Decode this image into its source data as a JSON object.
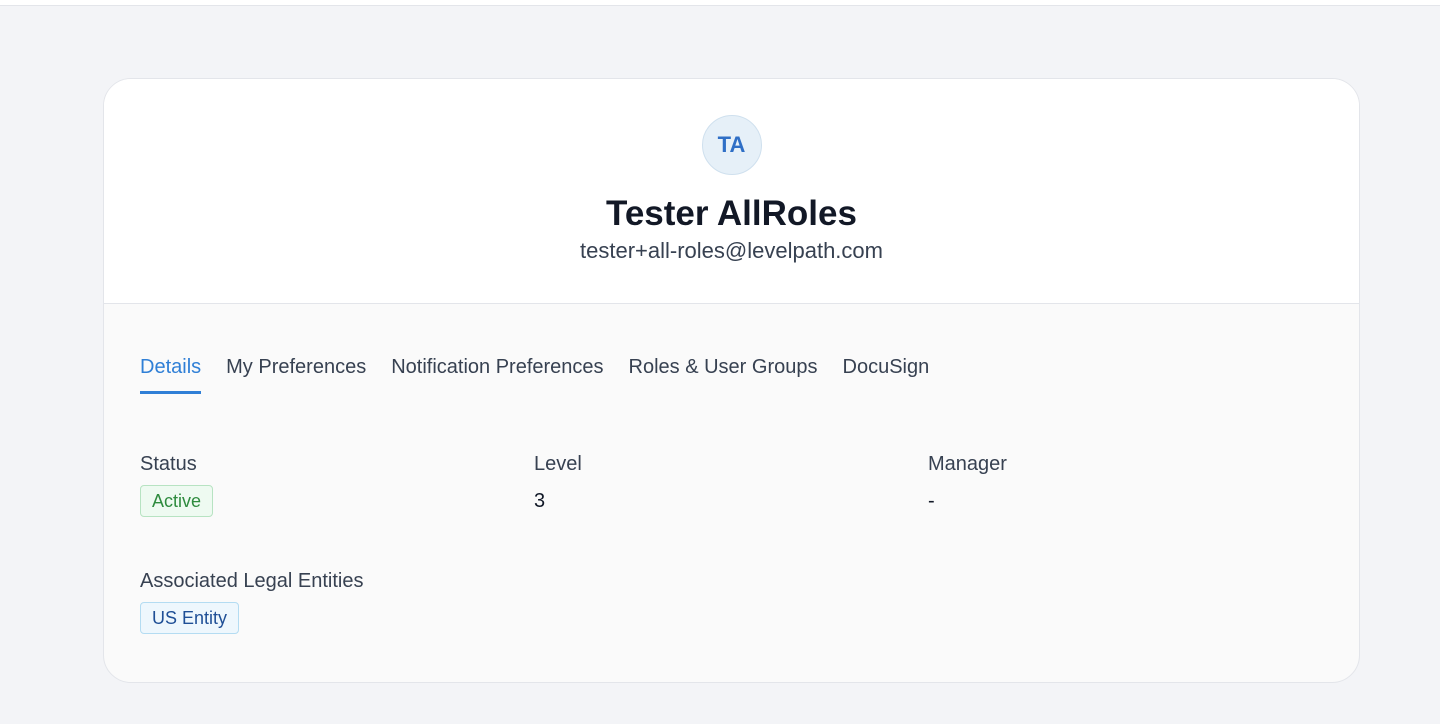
{
  "profile": {
    "initials": "TA",
    "name": "Tester AllRoles",
    "email": "tester+all-roles@levelpath.com"
  },
  "tabs": [
    {
      "label": "Details",
      "active": true
    },
    {
      "label": "My Preferences",
      "active": false
    },
    {
      "label": "Notification Preferences",
      "active": false
    },
    {
      "label": "Roles & User Groups",
      "active": false
    },
    {
      "label": "DocuSign",
      "active": false
    }
  ],
  "details": {
    "status_label": "Status",
    "status_value": "Active",
    "level_label": "Level",
    "level_value": "3",
    "manager_label": "Manager",
    "manager_value": "-",
    "entities_label": "Associated Legal Entities",
    "entities_value": "US Entity"
  },
  "colors": {
    "accent": "#2f7fd6",
    "status_active": "#2e8b3e",
    "entity_badge": "#1f4f96"
  }
}
